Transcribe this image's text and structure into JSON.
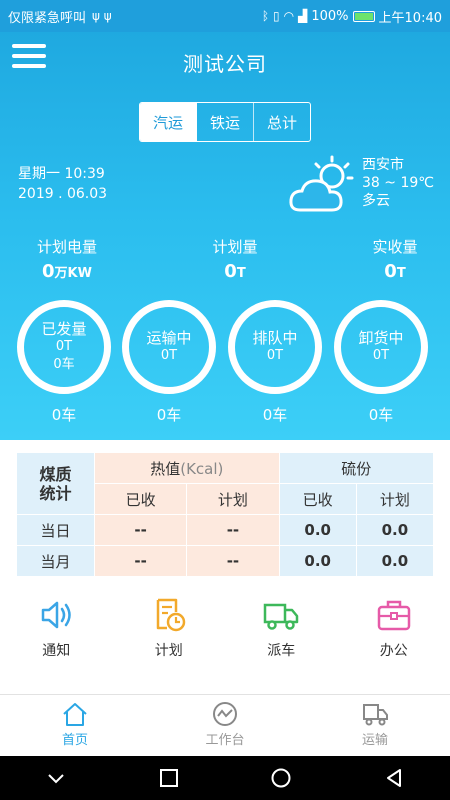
{
  "status_bar": {
    "carrier": "仅限紧急呼叫",
    "battery": "100%",
    "time": "上午10:40"
  },
  "header": {
    "title": "测试公司"
  },
  "tabs": [
    {
      "label": "汽运",
      "active": true
    },
    {
      "label": "铁运",
      "active": false
    },
    {
      "label": "总计",
      "active": false
    }
  ],
  "datetime": {
    "weekday_time": "星期一 10:39",
    "date": "2019 . 06.03"
  },
  "weather": {
    "city": "西安市",
    "temp": "38 ~ 19℃",
    "condition": "多云",
    "icon": "partly-cloudy-icon"
  },
  "stats": [
    {
      "label": "计划电量",
      "value": "0",
      "unit": "万KW"
    },
    {
      "label": "计划量",
      "value": "0",
      "unit": "T"
    },
    {
      "label": "实收量",
      "value": "0",
      "unit": "T"
    }
  ],
  "rings": [
    {
      "title": "已发量",
      "value": "0T",
      "extra": "0车",
      "count": "0车"
    },
    {
      "title": "运输中",
      "value": "0T",
      "extra": "",
      "count": "0车"
    },
    {
      "title": "排队中",
      "value": "0T",
      "extra": "",
      "count": "0车"
    },
    {
      "title": "卸货中",
      "value": "0T",
      "extra": "",
      "count": "0车"
    }
  ],
  "quality_table": {
    "corner": "煤质\n统计",
    "heat_label": "热值",
    "heat_unit": "(Kcal)",
    "sulfur_label": "硫份",
    "sub_headers": [
      "已收",
      "计划",
      "已收",
      "计划"
    ],
    "rows": [
      {
        "label": "当日",
        "cells": [
          "--",
          "--",
          "0.0",
          "0.0"
        ]
      },
      {
        "label": "当月",
        "cells": [
          "--",
          "--",
          "0.0",
          "0.0"
        ]
      }
    ]
  },
  "actions": [
    {
      "label": "通知",
      "icon": "speaker-icon",
      "color": "#3aa5e6"
    },
    {
      "label": "计划",
      "icon": "plan-clock-icon",
      "color": "#f2a92b"
    },
    {
      "label": "派车",
      "icon": "truck-icon",
      "color": "#3db85a"
    },
    {
      "label": "办公",
      "icon": "briefcase-icon",
      "color": "#e65aa8"
    }
  ],
  "bottom_nav": [
    {
      "label": "首页",
      "icon": "home-icon",
      "active": true
    },
    {
      "label": "工作台",
      "icon": "workbench-icon",
      "active": false
    },
    {
      "label": "运输",
      "icon": "transport-truck-icon",
      "active": false
    }
  ]
}
